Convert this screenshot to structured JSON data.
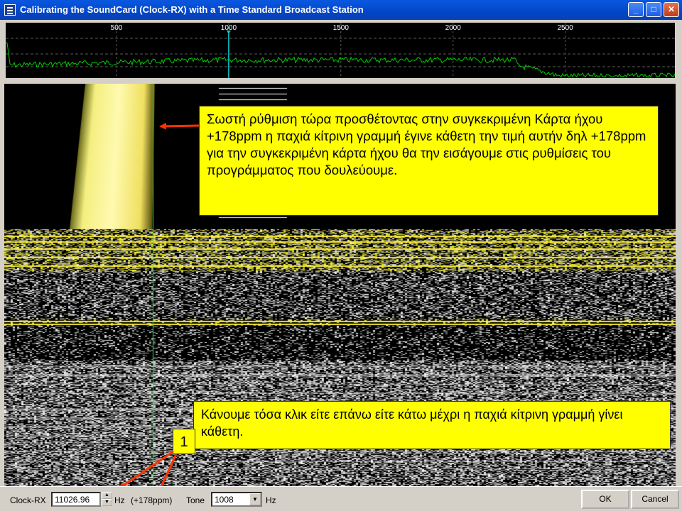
{
  "window": {
    "title": "Calibrating the SoundCard (Clock-RX) with a Time Standard Broadcast Station",
    "minimize_glyph": "_",
    "maximize_glyph": "□",
    "close_glyph": "✕"
  },
  "spectrum": {
    "ticks": [
      {
        "label": "500",
        "value": 500
      },
      {
        "label": "1000",
        "value": 1000
      },
      {
        "label": "1500",
        "value": 1500
      },
      {
        "label": "2000",
        "value": 2000
      },
      {
        "label": "2500",
        "value": 2500
      }
    ],
    "marker_value": 1000,
    "trace_color": "#00cc00",
    "marker_color": "#00cccc"
  },
  "annotations": {
    "top_callout": "Σωστή ρύθμιση τώρα προσθέτοντας στην συγκεκριμένη Κάρτα ήχου +178ppm η παχιά κίτρινη γραμμή έγινε κάθετη την τιμή αυτήν δηλ +178ppm για την συγκεκριμένη κάρτα ήχου θα την εισάγουμε στις ρυθμίσεις του προγράμματος που δουλεύουμε.",
    "bottom_callout": "Κάνουμε τόσα κλικ είτε επάνω είτε κάτω μέχρι η παχιά κίτρινη γραμμή γίνει κάθετη.",
    "step_number": "1",
    "callout_color": "#ffff00",
    "arrow_color": "#ff3300"
  },
  "statusbar": {
    "clock_label": "Clock-RX",
    "clock_value": "11026.96",
    "hz_label": "Hz",
    "ppm_text": "(+178ppm)",
    "tone_label": "Tone",
    "tone_value": "1008",
    "tone_hz_label": "Hz",
    "ok_label": "OK",
    "cancel_label": "Cancel"
  }
}
